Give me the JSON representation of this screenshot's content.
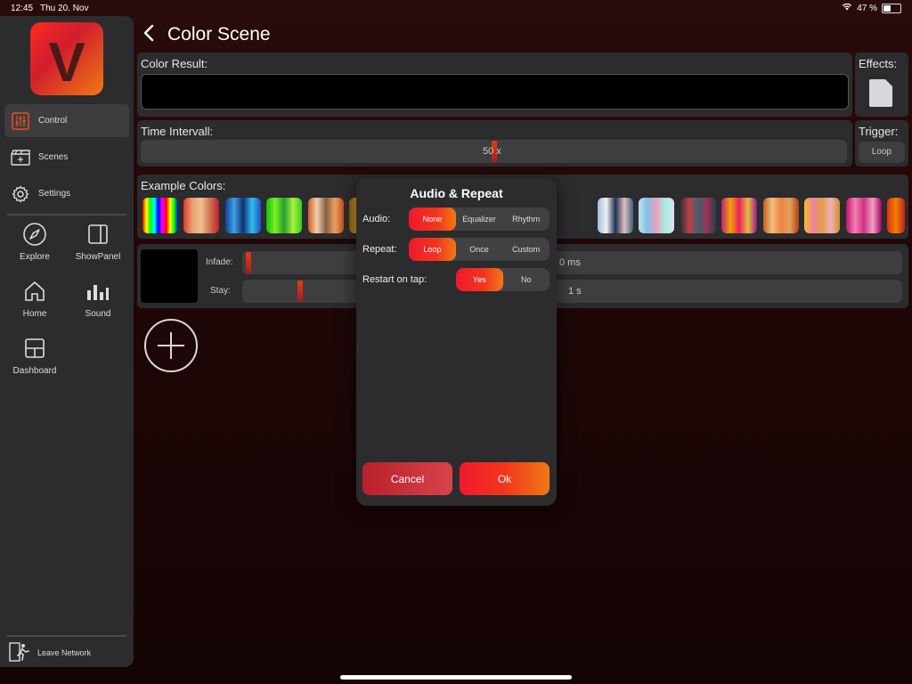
{
  "status_bar": {
    "time": "12:45",
    "date": "Thu 20. Nov",
    "battery": "47 %"
  },
  "sidebar": {
    "logo_letter": "V",
    "items": [
      {
        "label": "Control",
        "icon": "sliders-icon",
        "active": true
      },
      {
        "label": "Scenes",
        "icon": "clapperboard-icon",
        "active": false
      },
      {
        "label": "Settings",
        "icon": "gear-icon",
        "active": false
      }
    ],
    "tiles": [
      {
        "label": "Explore",
        "icon": "compass-icon"
      },
      {
        "label": "ShowPanel",
        "icon": "sidebar-panel-icon"
      },
      {
        "label": "Home",
        "icon": "home-icon"
      },
      {
        "label": "Sound",
        "icon": "bar-chart-icon"
      },
      {
        "label": "Dashboard",
        "icon": "dashboard-icon"
      }
    ],
    "leave_label": "Leave Network"
  },
  "header": {
    "title": "Color Scene"
  },
  "color_result": {
    "label": "Color Result:"
  },
  "effects": {
    "label": "Effects:"
  },
  "time_interval": {
    "label": "Time Intervall:",
    "value": "50 x",
    "fraction": 0.5
  },
  "trigger": {
    "label": "Trigger:",
    "button": "Loop"
  },
  "example_colors": {
    "label": "Example Colors:",
    "swatches": [
      "linear-gradient(90deg,#f00,#ff0,#0f0,#0ff,#00f,#f0f,#f00,#ff0,#0f0,#00f)",
      "linear-gradient(90deg,#e03a2a,#e8a070,#f0c090,#d07050,#c02030)",
      "linear-gradient(90deg,#1040a0,#40a0e0,#103070,#30c0f0,#2050c0)",
      "linear-gradient(90deg,#10c010,#80f020,#20a030,#b0f040,#30d020)",
      "linear-gradient(90deg,#d06020,#f0d0b0,#806040,#f0a060,#c05020)",
      "linear-gradient(90deg,#806010,#f0a030,#c04010,#f0d060,#702010)",
      "linear-gradient(90deg,#a0c0e0,#f0f0f0,#203050,#e0c0c0,#406080)",
      "linear-gradient(90deg,#c0e0f0,#80c0e0,#f0a0c0,#a0f0e0,#e0e0f0)",
      "linear-gradient(90deg,#303040,#c04040,#406070,#a03050,#204050)",
      "linear-gradient(90deg,#c02080,#f0a000,#f02060,#e0c040,#a01090)",
      "linear-gradient(90deg,#c06020,#f0c080,#f08040,#e0a060,#b04010)",
      "linear-gradient(90deg,#f0c020,#f080a0,#e0a040,#f0b0c0,#d09020)",
      "linear-gradient(90deg,#c01070,#f080b0,#d03080,#f0a0c0,#a00060)",
      "linear-gradient(90deg,#e03010,#f08000,#c02020)"
    ]
  },
  "scene_step": {
    "infade_label": "Infade:",
    "infade_value": "0 ms",
    "infade_fraction": 0.0,
    "stay_label": "Stay:",
    "stay_value": "1 s",
    "stay_fraction": 0.08
  },
  "modal": {
    "title": "Audio & Repeat",
    "audio": {
      "label": "Audio:",
      "options": [
        "None",
        "Equalizer",
        "Rhythm"
      ],
      "selected": "None"
    },
    "repeat": {
      "label": "Repeat:",
      "options": [
        "Loop",
        "Once",
        "Custom"
      ],
      "selected": "Loop"
    },
    "restart": {
      "label": "Restart on tap:",
      "options": [
        "Yes",
        "No"
      ],
      "selected": "Yes"
    },
    "cancel": "Cancel",
    "ok": "Ok"
  }
}
